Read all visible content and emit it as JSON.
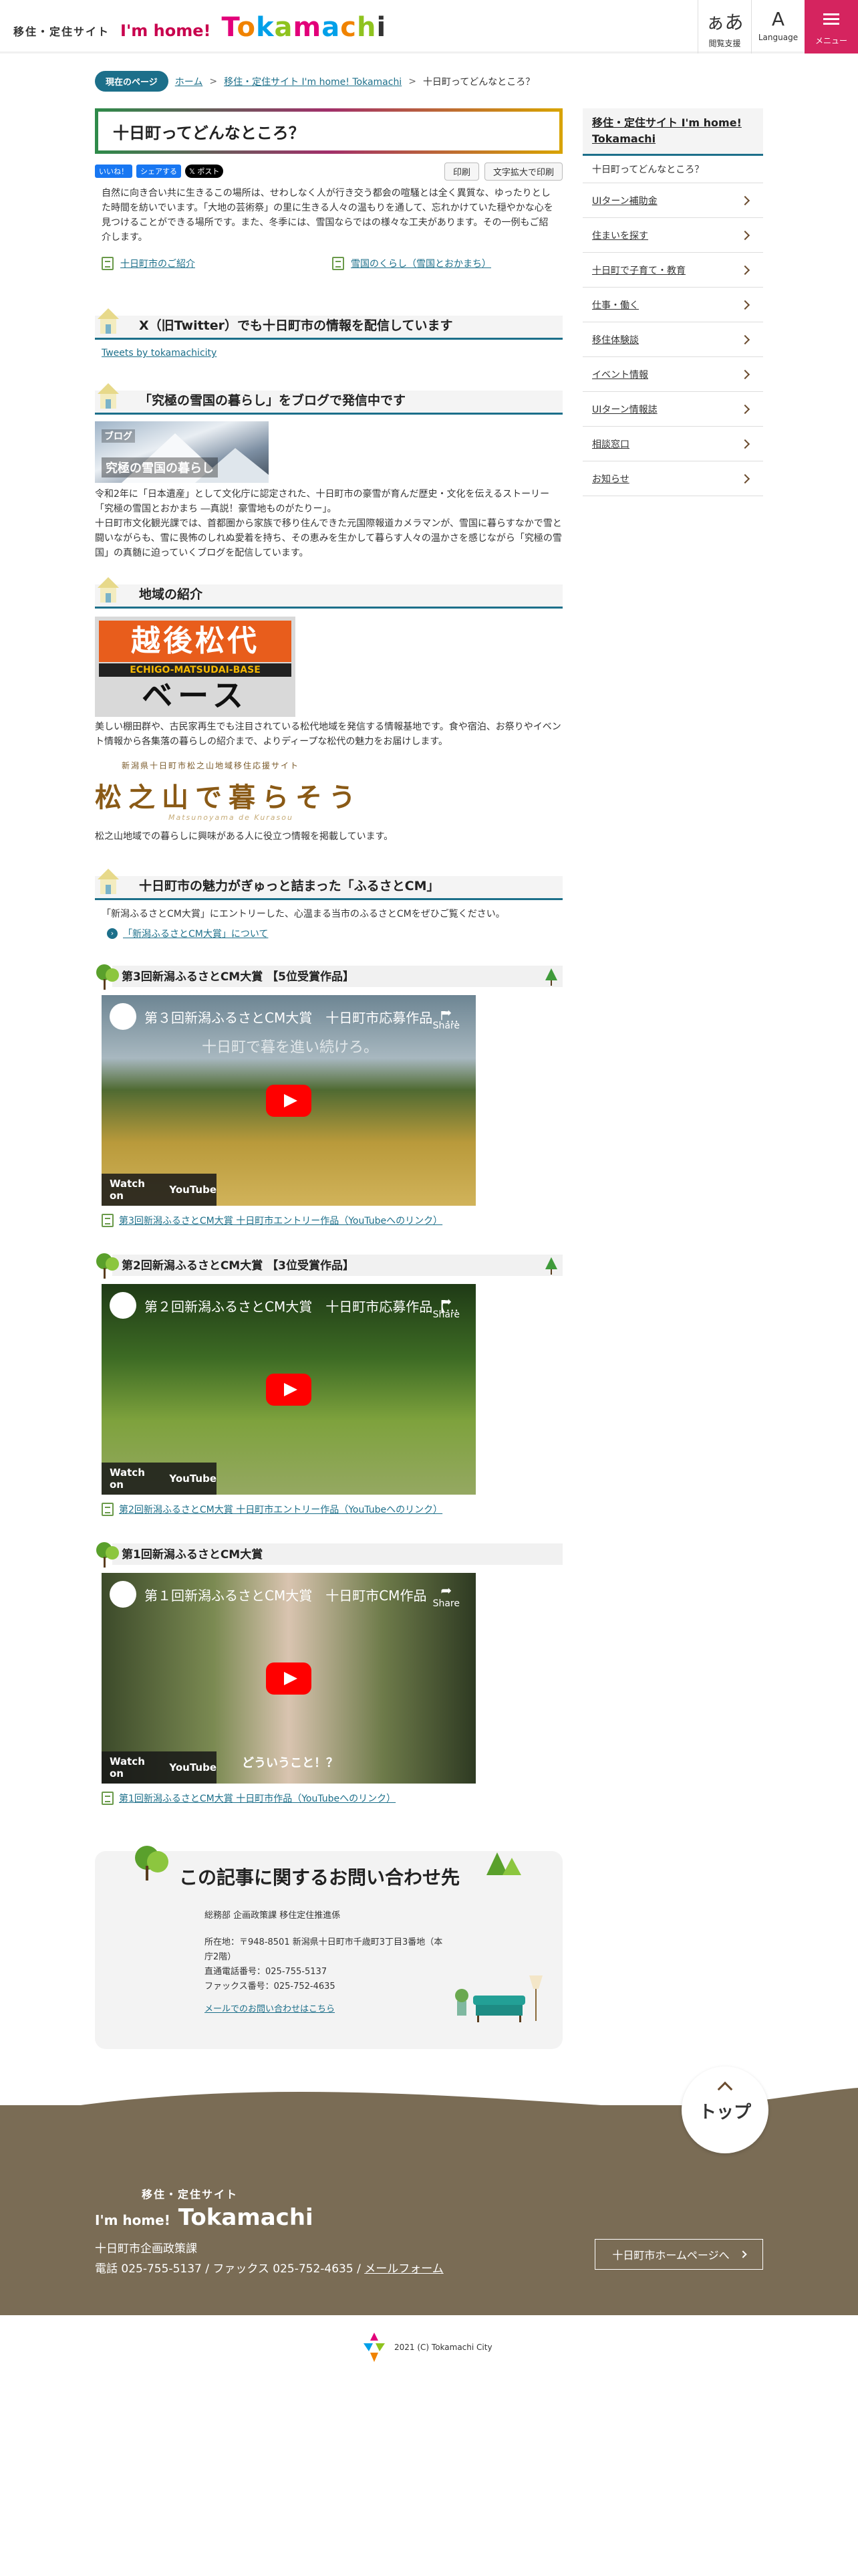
{
  "header": {
    "site_small": "移住・定住サイト",
    "im_home": "I'm home!",
    "brand_letters": [
      "T",
      "o",
      "k",
      "a",
      "m",
      "a",
      "c",
      "h",
      "i"
    ],
    "reading": {
      "glyph": "ぁあ",
      "label": "閲覧支援"
    },
    "language": {
      "glyph": "A",
      "label": "Language"
    },
    "menu": {
      "label": "メニュー"
    }
  },
  "breadcrumb": {
    "current_label": "現在のページ",
    "items": [
      "ホーム",
      "移住・定住サイト I'm home! Tokamachi",
      "十日町ってどんなところ？"
    ],
    "sep": ">"
  },
  "page": {
    "title": "十日町ってどんなところ？",
    "sns": {
      "like": "いいね！",
      "share": "シェアする",
      "post": "ポスト"
    },
    "print": "印刷",
    "print_large": "文字拡大で印刷",
    "lead": "自然に向き合い共に生きるこの場所は、せわしなく人が行き交う都会の喧騒とは全く異質な、ゆったりとした時間を紡いでいます。「大地の芸術祭」の里に生きる人々の温もりを通して、忘れかけていた穏やかな心を見つけることができる場所です。また、冬季には、雪国ならではの様々な工夫があります。その一例もご紹介します。",
    "link_intro": "十日町市のご紹介",
    "link_snow": "雪国のくらし（雪国とおかまち）"
  },
  "twitter": {
    "heading": "X（旧Twitter）でも十日町市の情報を配信しています",
    "link": "Tweets by tokamachicity"
  },
  "blog": {
    "heading": "「究極の雪国の暮らし」をブログで発信中です",
    "banner_top": "ブログ",
    "banner_main": "究極の雪国の暮らし",
    "text": "令和2年に「日本遺産」として文化庁に認定された、十日町市の豪雪が育んだ歴史・文化を伝えるストーリー「究極の雪国とおかまち ―真説！豪雪地ものがたりー」。\n十日町市文化観光課では、首都圏から家族で移り住んできた元国際報道カメラマンが、雪国に暮らすなかで雪と闘いながらも、雪に畏怖のしれぬ愛着を持ち、その恵みを生かして暮らす人々の温かさを感じながら「究極の雪国」の真髄に迫っていくブログを配信しています。"
  },
  "region": {
    "heading": "地域の紹介",
    "banner_main": "越後松代",
    "banner_sub": "ECHIGO-MATSUDAI-BASE",
    "banner_bottom": "ベース",
    "text1": "美しい棚田群や、古民家再生でも注目されている松代地域を発信する情報基地です。食や宿泊、お祭りやイベント情報から各集落の暮らしの紹介まで、よりディープな松代の魅力をお届けします。",
    "banner2_top": "新潟県十日町市松之山地域移住応援サイト",
    "banner2_main": "松之山で暮らそう",
    "banner2_sub": "Matsunoyama de Kurasou",
    "text2": "松之山地域での暮らしに興味がある人に役立つ情報を掲載しています。"
  },
  "cm": {
    "heading": "十日町市の魅力がぎゅっと詰まった「ふるさとCM」",
    "text": "「新潟ふるさとCM大賞」にエントリーした、心温まる当市のふるさとCMをぜひご覧ください。",
    "link": "「新潟ふるさとCM大賞」について",
    "watch_on": "Watch on",
    "youtube": "YouTube",
    "share": "Share",
    "entries": [
      {
        "heading": "第3回新潟ふるさとCM大賞 【5位受賞作品】",
        "video_title": "第３回新潟ふるさとCM大賞　十日町市応募作品「...",
        "overlay": "十日町で暮を進い続けろ。",
        "link": "第3回新潟ふるさとCM大賞 十日町市エントリー作品（YouTubeへのリンク）"
      },
      {
        "heading": "第2回新潟ふるさとCM大賞 【3位受賞作品】",
        "video_title": "第２回新潟ふるさとCM大賞　十日町市応募作品【...",
        "overlay": "",
        "link": "第2回新潟ふるさとCM大賞 十日町市エントリー作品（YouTubeへのリンク）"
      },
      {
        "heading": "第1回新潟ふるさとCM大賞",
        "video_title": "第１回新潟ふるさとCM大賞　十日町市CM作品",
        "overlay": "どういうこと！？",
        "link": "第1回新潟ふるさとCM大賞 十日町市作品（YouTubeへのリンク）"
      }
    ]
  },
  "contact": {
    "heading": "この記事に関するお問い合わせ先",
    "dept": "総務部 企画政策課 移住定住推進係",
    "address": "所在地：〒948-8501 新潟県十日町市千歳町3丁目3番地（本庁2階）",
    "tel": "直通電話番号：025-755-5137",
    "fax": "ファックス番号：025-752-4635",
    "mail": "メールでのお問い合わせはこちら"
  },
  "sidebar": {
    "title": "移住・定住サイト I'm home! Tokamachi",
    "current": "十日町ってどんなところ？",
    "items": [
      "UIターン補助金",
      "住まいを探す",
      "十日町で子育て・教育",
      "仕事・働く",
      "移住体験談",
      "イベント情報",
      "UIターン情報誌",
      "相談窓口",
      "お知らせ"
    ]
  },
  "footer": {
    "top": "トップ",
    "site_small": "移住・定住サイト",
    "im_home": "I'm home!",
    "brand": "Tokamachi",
    "org": "十日町市企画政策課",
    "phone_line": "電話 025-755-5137 / ファックス 025-752-4635 /",
    "mail_form": "メールフォーム",
    "hp_button": "十日町市ホームページへ",
    "copyright": "2021 (C) Tokamachi City"
  },
  "colors": {
    "accent": "#1c6f8a",
    "menu": "#d5245f",
    "footer": "#7a6c55"
  }
}
